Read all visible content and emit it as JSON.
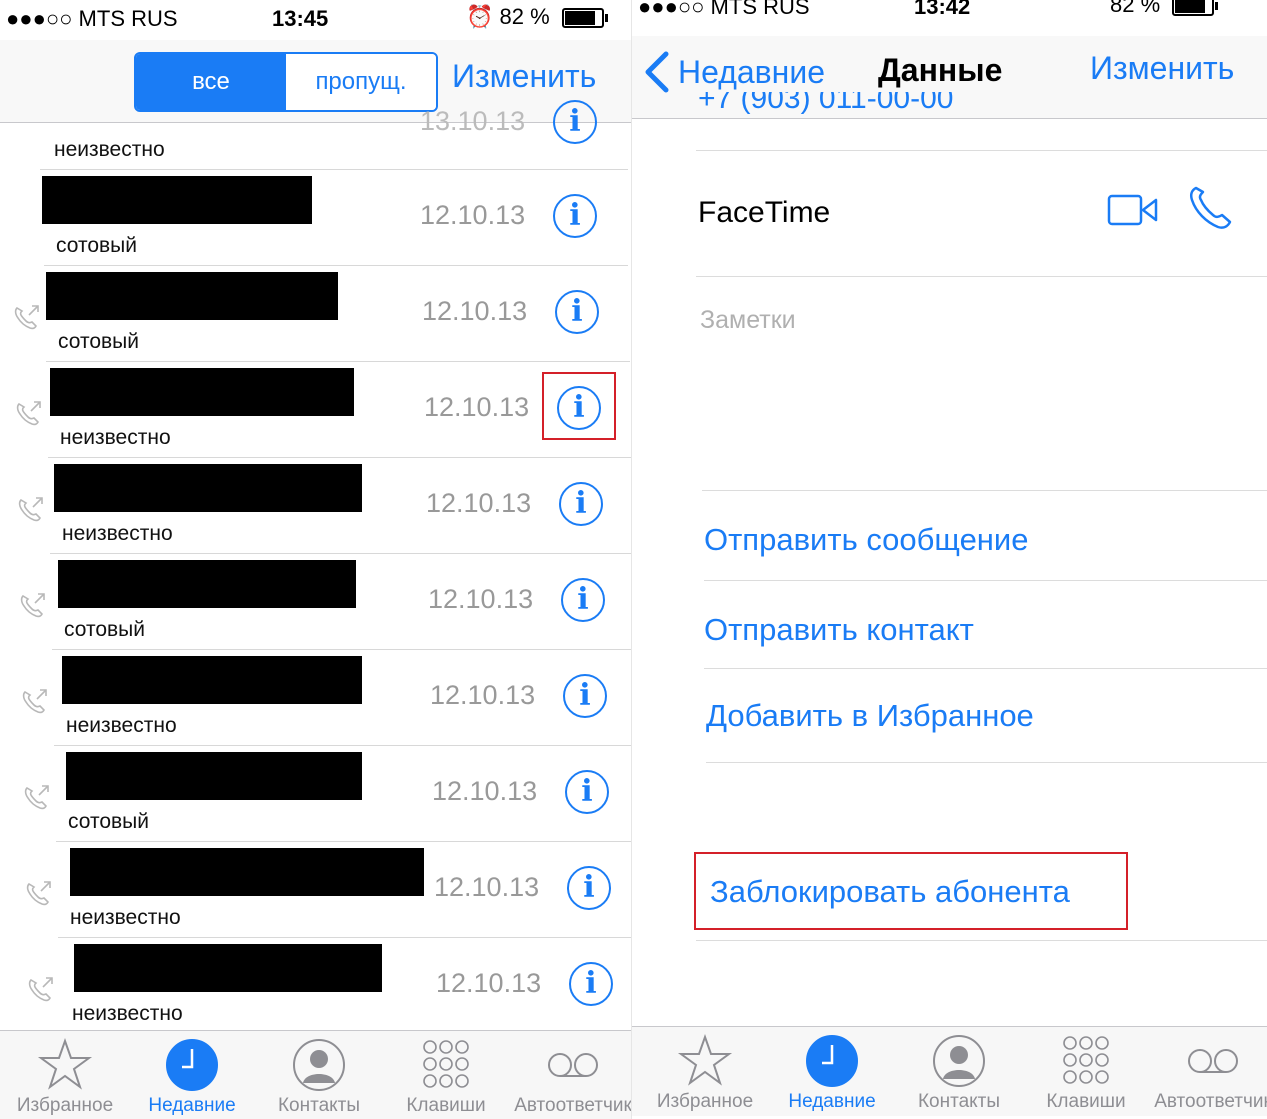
{
  "left_screen": {
    "status_bar": {
      "carrier": "●●●○○ MTS RUS",
      "time": "13:45",
      "battery": "82 %"
    },
    "nav": {
      "segment_all": "все",
      "segment_missed": "пропущ.",
      "edit": "Изменить"
    },
    "partial_row": {
      "date": "13.10.13",
      "type": "неизвестно"
    },
    "calls": [
      {
        "type": "сотовый",
        "date": "12.10.13"
      },
      {
        "type": "сотовый",
        "date": "12.10.13"
      },
      {
        "type": "неизвестно",
        "date": "12.10.13"
      },
      {
        "type": "неизвестно",
        "date": "12.10.13"
      },
      {
        "type": "сотовый",
        "date": "12.10.13"
      },
      {
        "type": "неизвестно",
        "date": "12.10.13"
      },
      {
        "type": "сотовый",
        "date": "12.10.13"
      },
      {
        "type": "неизвестно",
        "date": "12.10.13"
      },
      {
        "type": "неизвестно",
        "date": "12.10.13"
      }
    ],
    "info_glyph": "i",
    "tabs": [
      {
        "label": "Избранное",
        "icon": "star-icon"
      },
      {
        "label": "Недавние",
        "icon": "clock-icon"
      },
      {
        "label": "Контакты",
        "icon": "person-icon"
      },
      {
        "label": "Клавиши",
        "icon": "keypad-icon"
      },
      {
        "label": "Автоответчик",
        "icon": "voicemail-icon"
      }
    ]
  },
  "right_screen": {
    "status_bar": {
      "carrier": "●●●○○ MTS RUS",
      "time": "13:42",
      "battery": "82 %"
    },
    "nav": {
      "back": "Недавние",
      "title": "Данные",
      "edit": "Изменить"
    },
    "partial_phone": "+7 (903) 011-00-00",
    "facetime": "FaceTime",
    "notes": "Заметки",
    "actions": {
      "send_message": "Отправить сообщение",
      "send_contact": "Отправить контакт",
      "add_favorite": "Добавить в Избранное",
      "block": "Заблокировать абонента"
    },
    "tabs": [
      {
        "label": "Избранное",
        "icon": "star-icon"
      },
      {
        "label": "Недавние",
        "icon": "clock-icon"
      },
      {
        "label": "Контакты",
        "icon": "person-icon"
      },
      {
        "label": "Клавиши",
        "icon": "keypad-icon"
      },
      {
        "label": "Автоответчик",
        "icon": "voicemail-icon"
      }
    ]
  },
  "colors": {
    "accent": "#1a7cf5",
    "highlight": "#d42029",
    "redaction": "#000000"
  }
}
